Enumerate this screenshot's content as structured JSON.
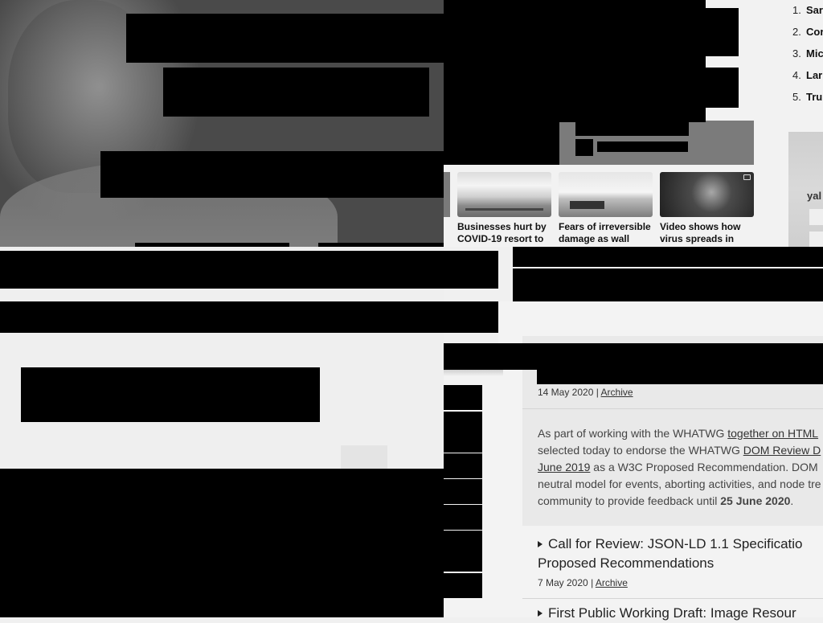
{
  "news_strip": {
    "thumbnails": [
      {
        "caption": "Businesses hurt by COVID-19 resort to"
      },
      {
        "caption": "Fears of irreversible damage as wall"
      },
      {
        "caption": "Video shows how virus spreads in"
      }
    ]
  },
  "trending": {
    "items": [
      {
        "num": "1.",
        "text": "Sar"
      },
      {
        "num": "2.",
        "text": "Cor"
      },
      {
        "num": "3.",
        "text": "Mic"
      },
      {
        "num": "4.",
        "text": "Lar"
      },
      {
        "num": "5.",
        "text": "Tru"
      }
    ],
    "ad_text": "yal"
  },
  "w3c": {
    "post1": {
      "date": "14 May 2020",
      "sep": "|",
      "category": "Archive",
      "body_before_link1": "As part of working with the WHATWG ",
      "link1": "together on HTML",
      "body_after_link1": " selected today to endorse the WHATWG ",
      "link2": "DOM Review D",
      "link3": "June 2019",
      "body_after_link3": " as a W3C Proposed Recommendation. DOM neutral model for events, aborting activities, and node tre community to provide feedback until ",
      "deadline": "25 June 2020",
      "end": "."
    },
    "post2": {
      "title_line1": "Call for Review: JSON-LD 1.1 Specificatio",
      "title_line2": "Proposed Recommendations",
      "date": "7 May 2020",
      "sep": "|",
      "category": "Archive"
    },
    "post3": {
      "title": "First Public Working Draft: Image Resour"
    }
  }
}
